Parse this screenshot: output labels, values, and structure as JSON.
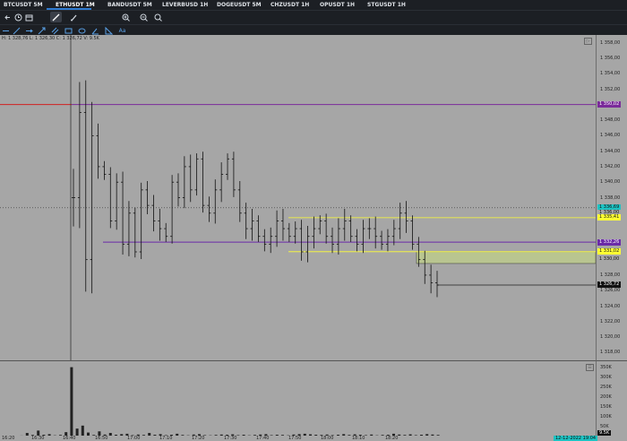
{
  "tabs": [
    {
      "label": "BTCUSDT 5M",
      "active": false
    },
    {
      "label": "ETHUSDT 1M",
      "active": true
    },
    {
      "label": "BANDUSDT 5M",
      "active": false
    },
    {
      "label": "LEVERBUSD 1H",
      "active": false
    },
    {
      "label": "DOGEUSDT 5M",
      "active": false
    },
    {
      "label": "CHZUSDT 1H",
      "active": false
    },
    {
      "label": "OPUSDT 1H",
      "active": false
    },
    {
      "label": "STGUSDT 1H",
      "active": false
    }
  ],
  "toolbar1": [
    "back-arrow",
    "clock",
    "calendar",
    "line-tool",
    "brush",
    "zoom-in",
    "zoom-out",
    "search"
  ],
  "toolbar2": [
    "cursor",
    "trend-line",
    "ray",
    "arrow",
    "parallel-channel",
    "rectangle",
    "ellipse",
    "angle",
    "measure",
    "text"
  ],
  "toolbar2_text": "Aa",
  "ohlc": "H: 1 328,76   L: 1 326,30   C: 1 326,72   V: 9.5K",
  "price_ticks": [
    "1 358,00",
    "1 356,00",
    "1 354,00",
    "1 352,00",
    "1 348,00",
    "1 346,00",
    "1 344,00",
    "1 342,00",
    "1 340,00",
    "1 338,00",
    "1 328,00",
    "1 326,00",
    "1 324,00",
    "1 322,00",
    "1 320,00",
    "1 318,00"
  ],
  "price_labels": [
    {
      "text": "1 350,02",
      "color": "#7a2a9a",
      "fg": "#ffffff"
    },
    {
      "text": "1 336,69",
      "color": "#1cc3c3",
      "fg": "#111111"
    },
    {
      "text": "1 336,00",
      "color": "#a6a6a6",
      "fg": "#111111"
    },
    {
      "text": "1 335,41",
      "color": "#ffff33",
      "fg": "#111111"
    },
    {
      "text": "1 332,26",
      "color": "#6a2aa8",
      "fg": "#ffffff"
    },
    {
      "text": "1 331,02",
      "color": "#ffff33",
      "fg": "#111111"
    },
    {
      "text": "1 330,00",
      "color": "#a6a6a6",
      "fg": "#111111"
    },
    {
      "text": "1 326,72",
      "color": "#111111",
      "fg": "#ffffff"
    }
  ],
  "volume_ticks": [
    "350K",
    "300K",
    "250K",
    "200K",
    "150K",
    "100K",
    "50K"
  ],
  "volume_last": "9.5K",
  "time_labels": [
    "16:20",
    "16:30",
    "16:40",
    "16:50",
    "17:00",
    "17:10",
    "17:20",
    "17:30",
    "17:40",
    "17:50",
    "18:00",
    "18:10",
    "18:20"
  ],
  "datetime": "12-12-2022 19:04",
  "colors": {
    "purple_line": "#7a2a9a",
    "red_line": "#d02020",
    "yellow": "#ffff33",
    "zone": "#b9c590"
  },
  "chart_data": {
    "type": "ohlc",
    "symbol": "ETHUSDT",
    "interval": "1M",
    "ylim": [
      1317,
      1359
    ],
    "horizontal_levels": [
      1350.02,
      1336.69,
      1335.41,
      1332.26,
      1331.02,
      1326.72
    ],
    "zone": [
      1329.5,
      1331.02
    ],
    "close_path": [
      1338,
      1349,
      1330,
      1346,
      1342,
      1341,
      1335,
      1340,
      1332,
      1336,
      1331,
      1339,
      1337,
      1335,
      1334,
      1333,
      1340,
      1338,
      1342,
      1339,
      1343,
      1337,
      1336,
      1339,
      1341,
      1343,
      1339,
      1336,
      1334,
      1335,
      1333,
      1332,
      1333,
      1335,
      1334,
      1333,
      1334,
      1331,
      1333,
      1334,
      1335,
      1333,
      1332,
      1334,
      1335,
      1333,
      1332,
      1334,
      1334,
      1333,
      1332,
      1333,
      1334,
      1336,
      1335,
      1332,
      1330,
      1328,
      1327,
      1326.72
    ],
    "volume_peak_k": 350
  }
}
